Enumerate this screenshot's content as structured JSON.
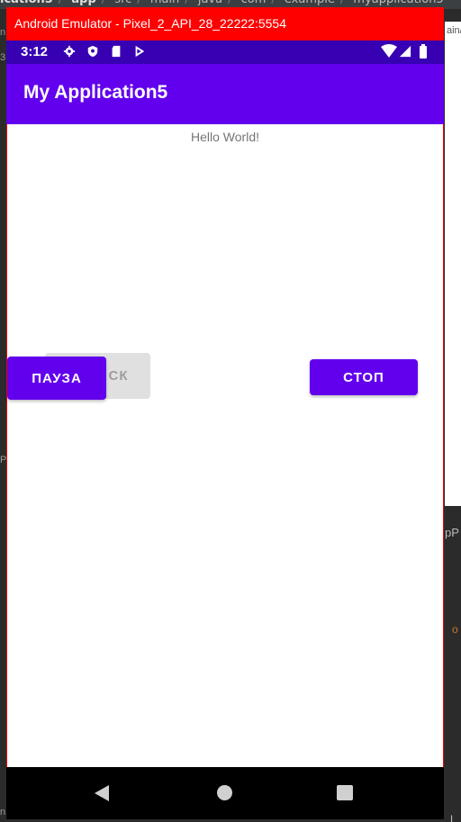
{
  "ide": {
    "breadcrumb": [
      "ication5",
      "app",
      "src",
      "main",
      "java",
      "com",
      "example",
      "myapplication5"
    ],
    "right_text_top": "ain/",
    "right_text_mid": "pP",
    "right_text_code": "o",
    "right_text_bottom": "L",
    "left_marks": [
      "n",
      "3",
      "P",
      "n"
    ]
  },
  "emulator": {
    "window_title": "Android Emulator - Pixel_2_API_28_22222:5554"
  },
  "status_bar": {
    "time": "3:12"
  },
  "app": {
    "title": "My Application5",
    "hello_text": "Hello World!",
    "buttons": {
      "start_label": "СТАРТ",
      "start_visible_text": "СК",
      "pause_label": "ПАУЗА",
      "stop_label": "СТОП"
    }
  },
  "colors": {
    "primary": "#6200ee",
    "primary_dark": "#3700b3",
    "emulator_border": "#ff0000"
  }
}
